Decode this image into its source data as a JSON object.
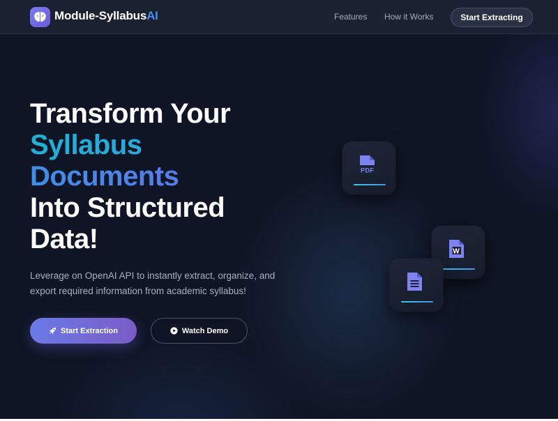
{
  "navbar": {
    "brand_main": "Module-Syllabus",
    "brand_accent": "AI",
    "links": [
      "Features",
      "How it Works"
    ],
    "cta_label": "Start Extracting"
  },
  "hero": {
    "title_lines": [
      "Transform Your",
      "Syllabus",
      "Documents",
      "Into Structured",
      "Data!"
    ],
    "subtitle": "Leverage on OpenAI API to instantly extract, organize, and export required information from academic syllabus!",
    "primary_button": "Start Extraction",
    "secondary_button": "Watch Demo"
  },
  "cards": [
    {
      "icon": "pdf-file-icon",
      "label": "PDF"
    },
    {
      "icon": "word-file-icon",
      "label": "W"
    },
    {
      "icon": "text-file-icon"
    }
  ],
  "colors": {
    "background": "#0f1524",
    "navbar": "#1a2130",
    "brand_accent": "#4b8df0",
    "gradient_cyan": "#1fb0d6",
    "gradient_blue": "#3d8fe8",
    "gradient_purple": "#6b6fe6",
    "primary_button_start": "#6a7ae8",
    "primary_button_end": "#7b5cc6",
    "icon_purple": "#7f83f0",
    "card_bar": "#3cc6e8"
  }
}
